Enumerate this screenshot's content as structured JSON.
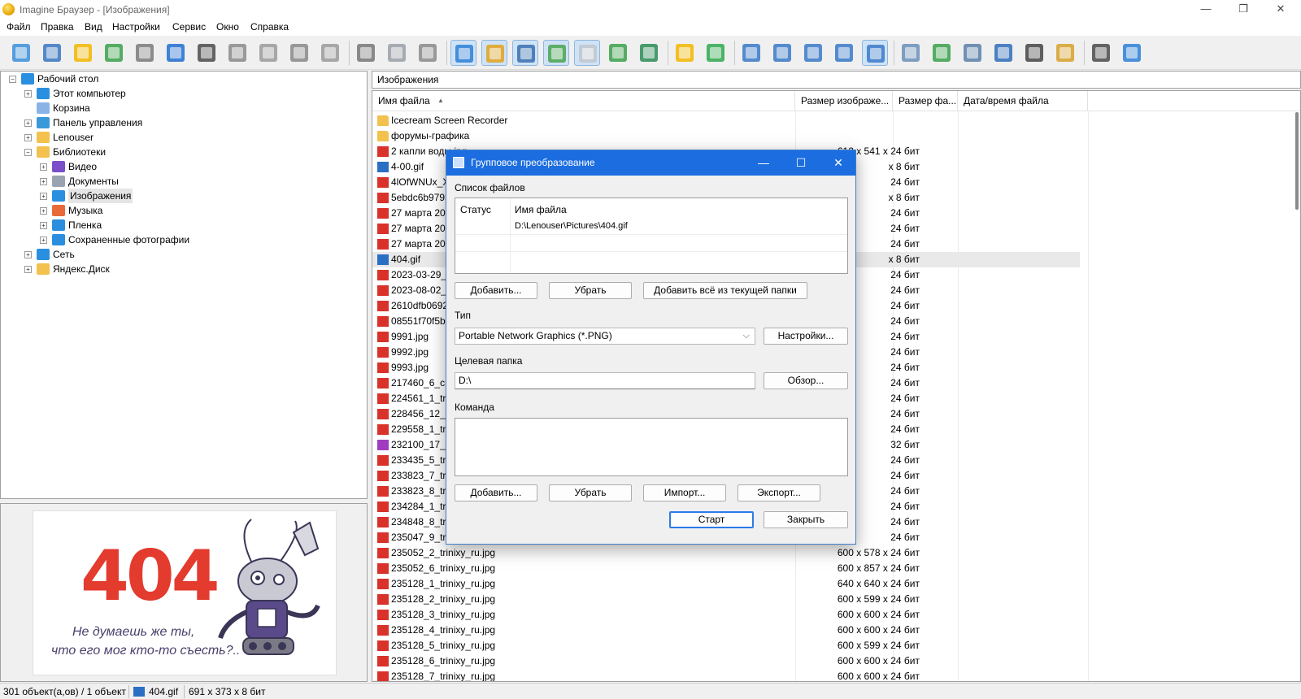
{
  "window": {
    "title": "Imagine Браузер - [Изображения]",
    "minimize": "—",
    "restore": "❐",
    "close": "✕"
  },
  "menu": [
    "Файл",
    "Правка",
    "Вид",
    "Настройки",
    "Сервис",
    "Окно",
    "Справка"
  ],
  "toolbar": {
    "icons": [
      "eye-icon",
      "slideshow-icon",
      "open-folder-icon",
      "save-icon",
      "print-icon",
      "info-icon",
      "camera-icon",
      "scanner-icon",
      "capture-icon",
      "trash-icon",
      "settings-icon",
      "cut-icon",
      "copy-icon",
      "paste-icon",
      "thumbnail-view-icon",
      "tree-view-icon",
      "clock-icon",
      "view-mode-icon",
      "grid-dots-icon",
      "fit-icon",
      "monitor-icon",
      "folder-up-icon",
      "refresh-icon",
      "large-icons-icon",
      "small-icons-icon",
      "list-view-icon",
      "details-view-icon",
      "report-view-icon",
      "tools-icon",
      "convert-icon",
      "batch-icon",
      "wallpaper-icon",
      "filmstrip-icon",
      "edit-icon",
      "pen-icon",
      "help-icon"
    ],
    "colors": [
      "#3b8fd9",
      "#3a76c0",
      "#f2b600",
      "#3aa04a",
      "#7a7a7a",
      "#1f6fd0",
      "#4b4b4b",
      "#8a8a8a",
      "#9a9a9a",
      "#888888",
      "#9a9a9a",
      "#777777",
      "#9aa0a8",
      "#8a8a8a",
      "#2d7fd6",
      "#e0a21f",
      "#3a6fb0",
      "#4aa34f",
      "#c0c6cc",
      "#3aa04a",
      "#2c8c56",
      "#f2b600",
      "#2fa84f",
      "#3a79c8",
      "#3a79c8",
      "#3a79c8",
      "#3a79c8",
      "#3a79c8",
      "#6a8fb8",
      "#3aa04a",
      "#5a7fa8",
      "#2f6db8",
      "#444444",
      "#d6a12c",
      "#4a4a4a",
      "#2d7fd6"
    ],
    "active": [
      14,
      15,
      16,
      17,
      18,
      27
    ]
  },
  "tree": [
    {
      "label": "Рабочий стол",
      "indent": 0,
      "exp": "−",
      "icon": "desktop-icon",
      "color": "#2b8fe0"
    },
    {
      "label": "Этот компьютер",
      "indent": 1,
      "exp": "+",
      "icon": "computer-icon",
      "color": "#2b8fe0"
    },
    {
      "label": "Корзина",
      "indent": 1,
      "exp": "",
      "icon": "recycle-bin-icon",
      "color": "#8ab4e6"
    },
    {
      "label": "Панель управления",
      "indent": 1,
      "exp": "+",
      "icon": "control-panel-icon",
      "color": "#3a9ad9"
    },
    {
      "label": "Lenouser",
      "indent": 1,
      "exp": "+",
      "icon": "folder-icon",
      "color": "#f2c14e"
    },
    {
      "label": "Библиотеки",
      "indent": 1,
      "exp": "−",
      "icon": "folder-icon",
      "color": "#f2c14e"
    },
    {
      "label": "Видео",
      "indent": 2,
      "exp": "+",
      "icon": "video-icon",
      "color": "#7a4fc8"
    },
    {
      "label": "Документы",
      "indent": 2,
      "exp": "+",
      "icon": "documents-icon",
      "color": "#9aa4b0"
    },
    {
      "label": "Изображения",
      "indent": 2,
      "exp": "+",
      "icon": "pictures-icon",
      "color": "#2b8fe0",
      "selected": true
    },
    {
      "label": "Музыка",
      "indent": 2,
      "exp": "+",
      "icon": "music-icon",
      "color": "#e86a3a"
    },
    {
      "label": "Пленка",
      "indent": 2,
      "exp": "+",
      "icon": "camera-roll-icon",
      "color": "#2b8fe0"
    },
    {
      "label": "Сохраненные фотографии",
      "indent": 2,
      "exp": "+",
      "icon": "saved-photos-icon",
      "color": "#2b8fe0"
    },
    {
      "label": "Сеть",
      "indent": 1,
      "exp": "+",
      "icon": "network-icon",
      "color": "#2b8fe0"
    },
    {
      "label": "Яндекс.Диск",
      "indent": 1,
      "exp": "+",
      "icon": "folder-icon",
      "color": "#f2c14e"
    }
  ],
  "preview": {
    "big": "404",
    "line1": "Не думаешь же ты,",
    "line2": "что его мог кто-то съесть?.."
  },
  "path": {
    "value": "Изображения",
    "dropdown": "⌵"
  },
  "columns": {
    "name": "Имя файла",
    "sort": "▲",
    "imgsize": "Размер изображе...",
    "filesize": "Размер фа...",
    "datetime": "Дата/время файла"
  },
  "files": [
    {
      "name": "Icecream Screen Recorder",
      "type": "folder",
      "size": ""
    },
    {
      "name": "форумы-графика",
      "type": "folder",
      "size": ""
    },
    {
      "name": "2 капли воды.jpg",
      "type": "jpg",
      "size": "612 x 541 x 24 бит"
    },
    {
      "name": "4-00.gif",
      "type": "gif",
      "size": "x 8 бит"
    },
    {
      "name": "4lOfWNUx_X",
      "type": "jpg",
      "size": "24 бит"
    },
    {
      "name": "5ebdc6b9793",
      "type": "jpg",
      "size": "x 8 бит"
    },
    {
      "name": "27 марта 202",
      "type": "jpg",
      "size": "24 бит"
    },
    {
      "name": "27 марта 202",
      "type": "jpg",
      "size": "24 бит"
    },
    {
      "name": "27 марта 202",
      "type": "jpg",
      "size": "24 бит"
    },
    {
      "name": "404.gif",
      "type": "gif",
      "size": "x 8 бит",
      "selected": true
    },
    {
      "name": "2023-03-29_0",
      "type": "jpg",
      "size": "24 бит"
    },
    {
      "name": "2023-08-02_0",
      "type": "jpg",
      "size": "24 бит"
    },
    {
      "name": "2610dfb0692",
      "type": "jpg",
      "size": "24 бит"
    },
    {
      "name": "08551f70f5b7",
      "type": "jpg",
      "size": "24 бит"
    },
    {
      "name": "9991.jpg",
      "type": "jpg",
      "size": "24 бит"
    },
    {
      "name": "9992.jpg",
      "type": "jpg",
      "size": "24 бит"
    },
    {
      "name": "9993.jpg",
      "type": "jpg",
      "size": "24 бит"
    },
    {
      "name": "217460_6_cr.j",
      "type": "jpg",
      "size": "24 бит"
    },
    {
      "name": "224561_1_trir",
      "type": "jpg",
      "size": "24 бит"
    },
    {
      "name": "228456_12_tr",
      "type": "jpg",
      "size": "24 бит"
    },
    {
      "name": "229558_1_trir",
      "type": "jpg",
      "size": "24 бит"
    },
    {
      "name": "232100_17_tr",
      "type": "png",
      "size": "32 бит"
    },
    {
      "name": "233435_5_trir",
      "type": "jpg",
      "size": "24 бит"
    },
    {
      "name": "233823_7_trir",
      "type": "jpg",
      "size": "24 бит"
    },
    {
      "name": "233823_8_trir",
      "type": "jpg",
      "size": "24 бит"
    },
    {
      "name": "234284_1_trir",
      "type": "jpg",
      "size": "24 бит"
    },
    {
      "name": "234848_8_trir",
      "type": "jpg",
      "size": "24 бит"
    },
    {
      "name": "235047_9_trir",
      "type": "jpg",
      "size": "24 бит"
    },
    {
      "name": "235052_2_trinixy_ru.jpg",
      "type": "jpg",
      "size": "600 x 578 x 24 бит"
    },
    {
      "name": "235052_6_trinixy_ru.jpg",
      "type": "jpg",
      "size": "600 x 857 x 24 бит"
    },
    {
      "name": "235128_1_trinixy_ru.jpg",
      "type": "jpg",
      "size": "640 x 640 x 24 бит"
    },
    {
      "name": "235128_2_trinixy_ru.jpg",
      "type": "jpg",
      "size": "600 x 599 x 24 бит"
    },
    {
      "name": "235128_3_trinixy_ru.jpg",
      "type": "jpg",
      "size": "600 x 600 x 24 бит"
    },
    {
      "name": "235128_4_trinixy_ru.jpg",
      "type": "jpg",
      "size": "600 x 600 x 24 бит"
    },
    {
      "name": "235128_5_trinixy_ru.jpg",
      "type": "jpg",
      "size": "600 x 599 x 24 бит"
    },
    {
      "name": "235128_6_trinixy_ru.jpg",
      "type": "jpg",
      "size": "600 x 600 x 24 бит"
    },
    {
      "name": "235128_7_trinixy_ru.jpg",
      "type": "jpg",
      "size": "600 x 600 x 24 бит"
    }
  ],
  "icon_colors": {
    "folder": "#f2c14e",
    "jpg": "#d9322a",
    "gif": "#2b6fc4",
    "png": "#a03cc0"
  },
  "status": {
    "count": "301 объект(а,ов) / 1 объект",
    "file": "404.gif",
    "dims": "691 x 373 x 8 бит"
  },
  "dialog": {
    "title": "Групповое преобразование",
    "minimize": "—",
    "maximize": "☐",
    "close": "✕",
    "files_label": "Список файлов",
    "col_status": "Статус",
    "col_filename": "Имя файла",
    "file_entry": "D:\\Lenouser\\Pictures\\404.gif",
    "add_btn": "Добавить...",
    "remove_btn": "Убрать",
    "add_all_btn": "Добавить всё из текущей папки",
    "type_label": "Тип",
    "type_value": "Portable Network Graphics (*.PNG)",
    "type_arrow": "⌵",
    "settings_btn": "Настройки...",
    "target_label": "Целевая папка",
    "target_value": "D:\\",
    "browse_btn": "Обзор...",
    "command_label": "Команда",
    "cmd_add_btn": "Добавить...",
    "cmd_remove_btn": "Убрать",
    "import_btn": "Импорт...",
    "export_btn": "Экспорт...",
    "start_btn": "Старт",
    "close_btn": "Закрыть"
  }
}
